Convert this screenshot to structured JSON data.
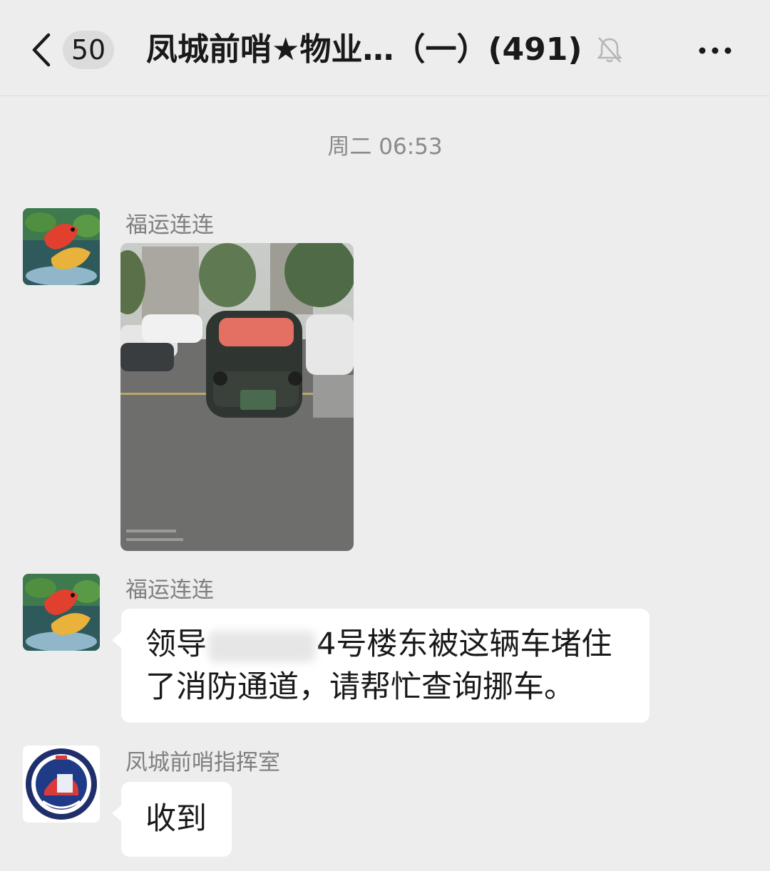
{
  "header": {
    "unread_count": "50",
    "title": "凤城前哨★物业…（一）(491)"
  },
  "chat": {
    "timestamp": "周二 06:53",
    "messages": [
      {
        "sender": "福运连连",
        "type": "image"
      },
      {
        "sender": "福运连连",
        "type": "text",
        "text_line1_start": "领导",
        "text_line1_end": "4号楼东被这辆车堵住",
        "text_line2": "了消防通道，请帮忙查询挪车。"
      },
      {
        "sender": "凤城前哨指挥室",
        "type": "text",
        "text": "收到"
      }
    ]
  },
  "icons": {
    "back": "chevron-left-icon",
    "mute": "bell-off-icon",
    "more": "ellipsis-icon",
    "avatar1": "koi-fish-avatar",
    "avatar2": "police-emblem-avatar"
  }
}
